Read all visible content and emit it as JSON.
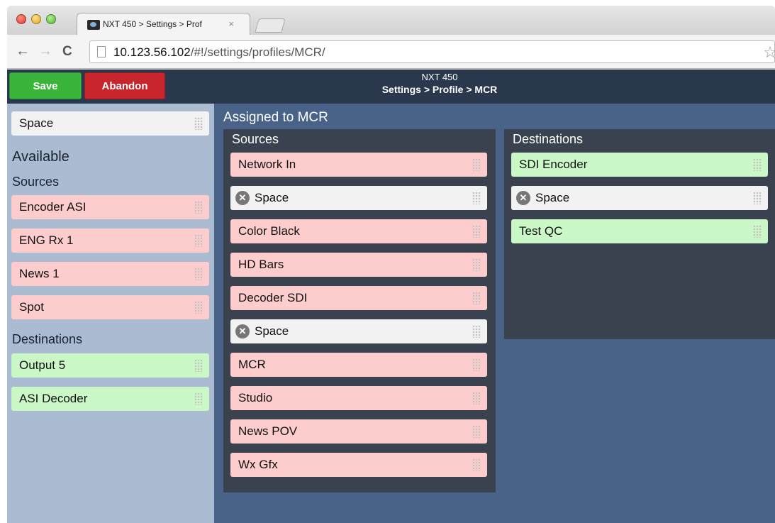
{
  "browser": {
    "tab_title": "NXT 450 > Settings > Prof",
    "tab_close": "×",
    "url_host": "10.123.56.102",
    "url_path": "/#!/settings/profiles/MCR/",
    "back_glyph": "←",
    "forward_glyph": "→",
    "reload_glyph": "C",
    "star_glyph": "☆"
  },
  "header": {
    "save_label": "Save",
    "abandon_label": "Abandon",
    "device": "NXT 450",
    "breadcrumb": "Settings > Profile > MCR"
  },
  "left": {
    "space_label": "Space",
    "available_heading": "Available",
    "sources_heading": "Sources",
    "sources": [
      "Encoder ASI",
      "ENG Rx 1",
      "News 1",
      "Spot"
    ],
    "destinations_heading": "Destinations",
    "destinations": [
      "Output 5",
      "ASI Decoder"
    ]
  },
  "main": {
    "title": "Assigned to MCR",
    "sources_heading": "Sources",
    "sources": [
      {
        "label": "Network In",
        "kind": "source"
      },
      {
        "label": "Space",
        "kind": "space"
      },
      {
        "label": "Color Black",
        "kind": "source"
      },
      {
        "label": "HD Bars",
        "kind": "source"
      },
      {
        "label": "Decoder SDI",
        "kind": "source"
      },
      {
        "label": "Space",
        "kind": "space"
      },
      {
        "label": "MCR",
        "kind": "source"
      },
      {
        "label": "Studio",
        "kind": "source"
      },
      {
        "label": "News POV",
        "kind": "source"
      },
      {
        "label": "Wx Gfx",
        "kind": "source"
      }
    ],
    "destinations_heading": "Destinations",
    "destinations": [
      {
        "label": "SDI Encoder",
        "kind": "destination"
      },
      {
        "label": "Space",
        "kind": "space"
      },
      {
        "label": "Test QC",
        "kind": "destination"
      }
    ]
  },
  "icons": {
    "remove": "✕",
    "grip": "drag-grip-icon"
  },
  "colors": {
    "source": "#fdcdcd",
    "destination": "#cbf8c7",
    "space": "#f2f2f2",
    "save": "#3bb43c",
    "abandon": "#c9252d"
  }
}
